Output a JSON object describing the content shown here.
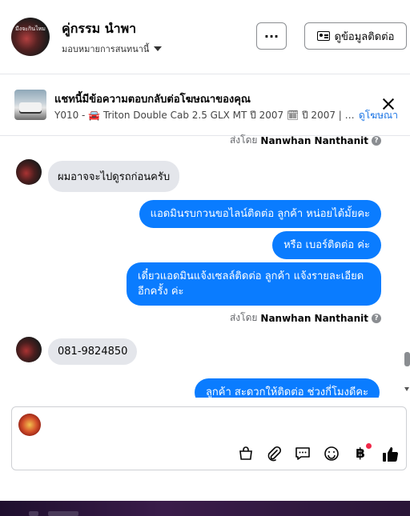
{
  "header": {
    "contact_name": "คู่กรรม นำพา",
    "assign_label": "มอบหมายการสนทนานี้",
    "more_label": "···",
    "contact_info_label": "ดูข้อมูลติดต่อ",
    "avatar_text": "มีงจะกินไหม"
  },
  "ad": {
    "title": "แชทนี้มีข้อความตอบกลับต่อโฆษณาของคุณ",
    "subtitle": "Y010 - 🚘 Triton Double Cab 2.5 GLX MT ปี 2007 🗓 ปี 2007 | ⚙ เ...",
    "link_label": "ดูโฆษณา"
  },
  "messages": {
    "sent_by_prefix": "ส่งโดย",
    "sender": "Nanwhan Nanthanit",
    "help_mark": "?",
    "in_1": "ผมอาจจะไปดูรถก่อนครับ",
    "out_1": "แอดมินรบกวนขอไลน์ติดต่อ ลูกค้า  หน่อยได้มั้ยคะ",
    "out_2": "หรือ เบอร์ติดต่อ ค่ะ",
    "out_3": "เดี๋ยวแอดมินแจ้งเซลล์ติดต่อ ลูกค้า  แจ้งรายละเอียด อีกครั้ง ค่ะ",
    "in_2": "081-9824850",
    "out_4": "ลูกค้า สะดวกให้ติดต่อ ช่วงกี่โมงดีคะ"
  },
  "composer": {
    "tools": [
      "shopping-bag-icon",
      "attachment-icon",
      "saved-reply-icon",
      "emoji-icon",
      "baht-payment-icon",
      "like-icon"
    ],
    "baht_symbol": "฿"
  },
  "colors": {
    "outgoing_bubble": "#0a7cff",
    "incoming_bubble": "#e4e6eb",
    "link": "#1b74e4",
    "notification_dot": "#f02849"
  }
}
